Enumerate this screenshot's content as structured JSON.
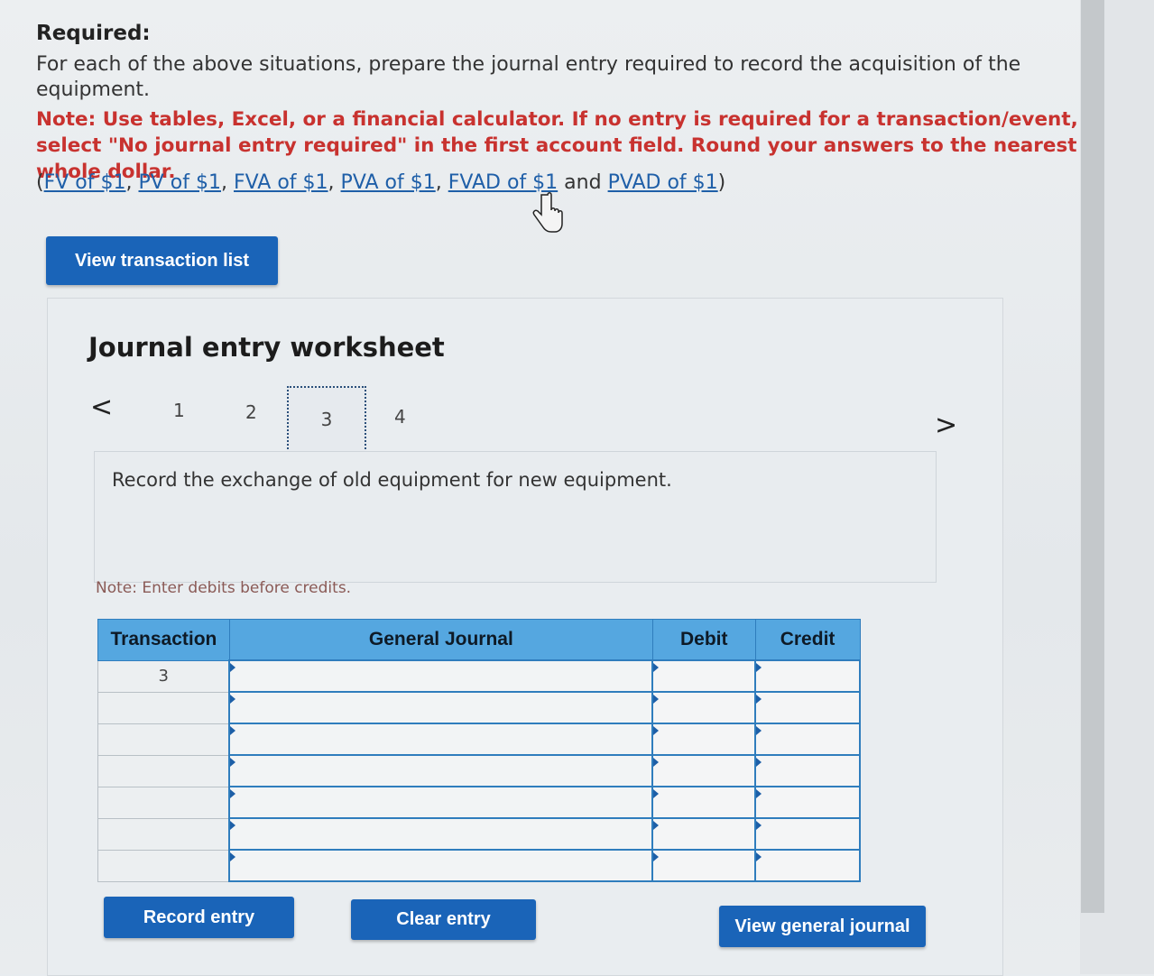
{
  "required": {
    "label": "Required:",
    "text": "For each of the above situations, prepare the journal entry required to record the acquisition of the equipment.",
    "note": "Note: Use tables, Excel, or a financial calculator. If no entry is required for a transaction/event, select \"No journal entry required\" in the first account field. Round your answers to the nearest whole dollar.",
    "links": {
      "open": "(",
      "fv": "FV of $1",
      "pv": "PV of $1",
      "fva": "FVA of $1",
      "pva": "PVA of $1",
      "fvad": "FVAD of $1",
      "and": " and ",
      "pvad": "PVAD of $1",
      "close": ")",
      "sep": ", "
    }
  },
  "buttons": {
    "view_transaction_list": "View transaction list",
    "record_entry": "Record entry",
    "clear_entry": "Clear entry",
    "view_general_journal": "View general journal"
  },
  "worksheet": {
    "title": "Journal entry worksheet",
    "pages": [
      "1",
      "2",
      "3",
      "4"
    ],
    "current_page": "3",
    "prev_glyph": "<",
    "next_glyph": ">",
    "description": "Record the exchange of old equipment for new equipment.",
    "note": "Note: Enter debits before credits."
  },
  "table": {
    "headers": {
      "transaction": "Transaction",
      "general_journal": "General Journal",
      "debit": "Debit",
      "credit": "Credit"
    },
    "transaction_number": "3",
    "rows": 7
  },
  "colors": {
    "accent_blue": "#1a64b8",
    "header_blue": "#55a7e0",
    "note_red": "#c8322f",
    "link_blue": "#1f5fa8"
  }
}
